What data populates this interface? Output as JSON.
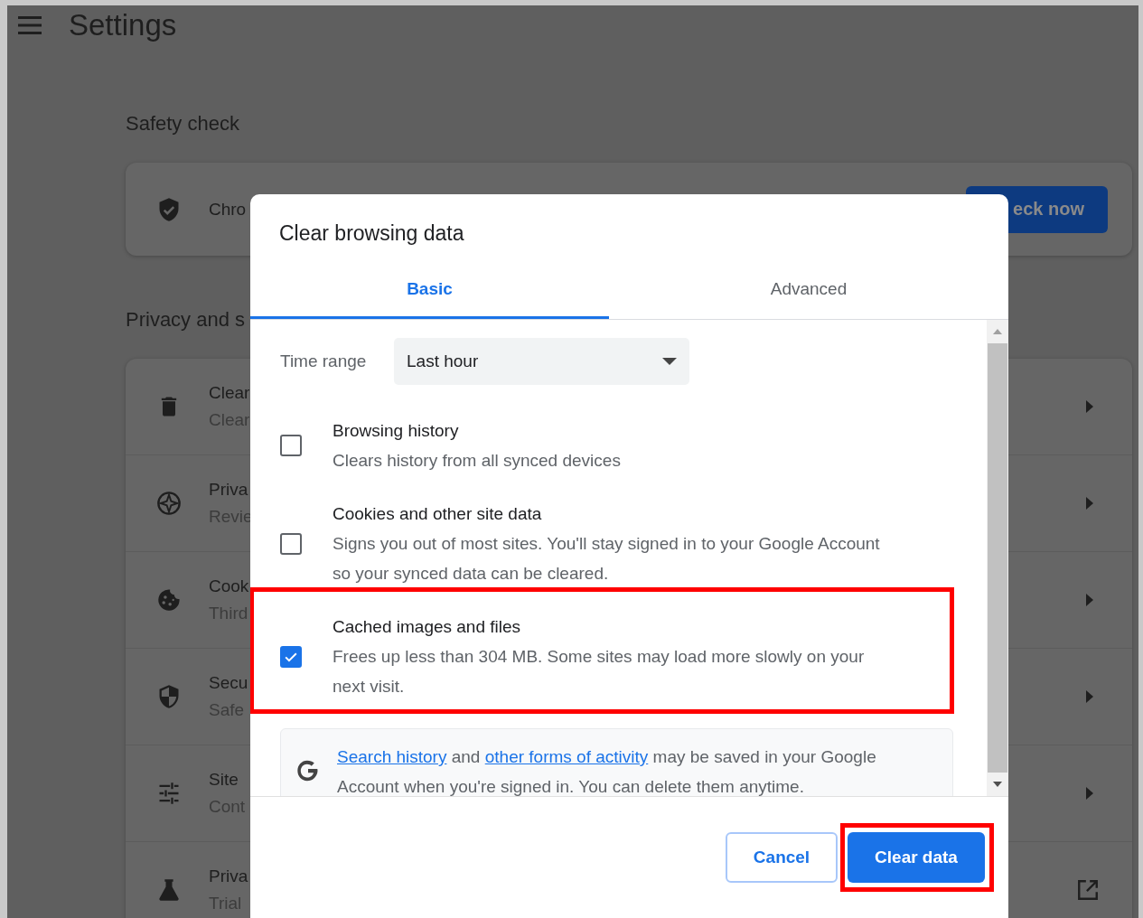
{
  "settings": {
    "title": "Settings",
    "sections": [
      {
        "heading": "Safety check",
        "rows": [
          {
            "kind": "action",
            "title": "Chro",
            "button": "eck now"
          }
        ]
      },
      {
        "heading": "Privacy and s",
        "rows": [
          {
            "kind": "submenu",
            "title": "Clear",
            "subtitle": "Clear"
          },
          {
            "kind": "submenu",
            "title": "Priva",
            "subtitle": "Revie"
          },
          {
            "kind": "submenu",
            "title": "Cook",
            "subtitle": "Third"
          },
          {
            "kind": "submenu",
            "title": "Secu",
            "subtitle": "Safe"
          },
          {
            "kind": "submenu",
            "title": "Site",
            "subtitle": "Cont"
          },
          {
            "kind": "external",
            "title": "Priva",
            "subtitle": "Trial"
          }
        ]
      }
    ]
  },
  "dialog": {
    "title": "Clear browsing data",
    "tabs": [
      {
        "label": "Basic",
        "selected": true
      },
      {
        "label": "Advanced",
        "selected": false
      }
    ],
    "time_range": {
      "label": "Time range",
      "value": "Last hour"
    },
    "options": [
      {
        "title": "Browsing history",
        "description": "Clears history from all synced devices",
        "checked": false,
        "highlighted": false
      },
      {
        "title": "Cookies and other site data",
        "description": "Signs you out of most sites. You'll stay signed in to your Google Account so your synced data can be cleared.",
        "checked": false,
        "highlighted": false
      },
      {
        "title": "Cached images and files",
        "description": "Frees up less than 304 MB. Some sites may load more slowly on your next visit.",
        "checked": true,
        "highlighted": true
      }
    ],
    "notice": {
      "parts": [
        {
          "kind": "link",
          "text": "Search history"
        },
        {
          "kind": "text",
          "text": " and "
        },
        {
          "kind": "link",
          "text": "other forms of activity"
        },
        {
          "kind": "text",
          "text": " may be saved in your Google Account when you're signed in. You can delete them anytime."
        }
      ]
    },
    "buttons": [
      {
        "label": "Cancel",
        "kind": "secondary",
        "highlighted": false
      },
      {
        "label": "Clear data",
        "kind": "primary",
        "highlighted": true
      }
    ]
  }
}
